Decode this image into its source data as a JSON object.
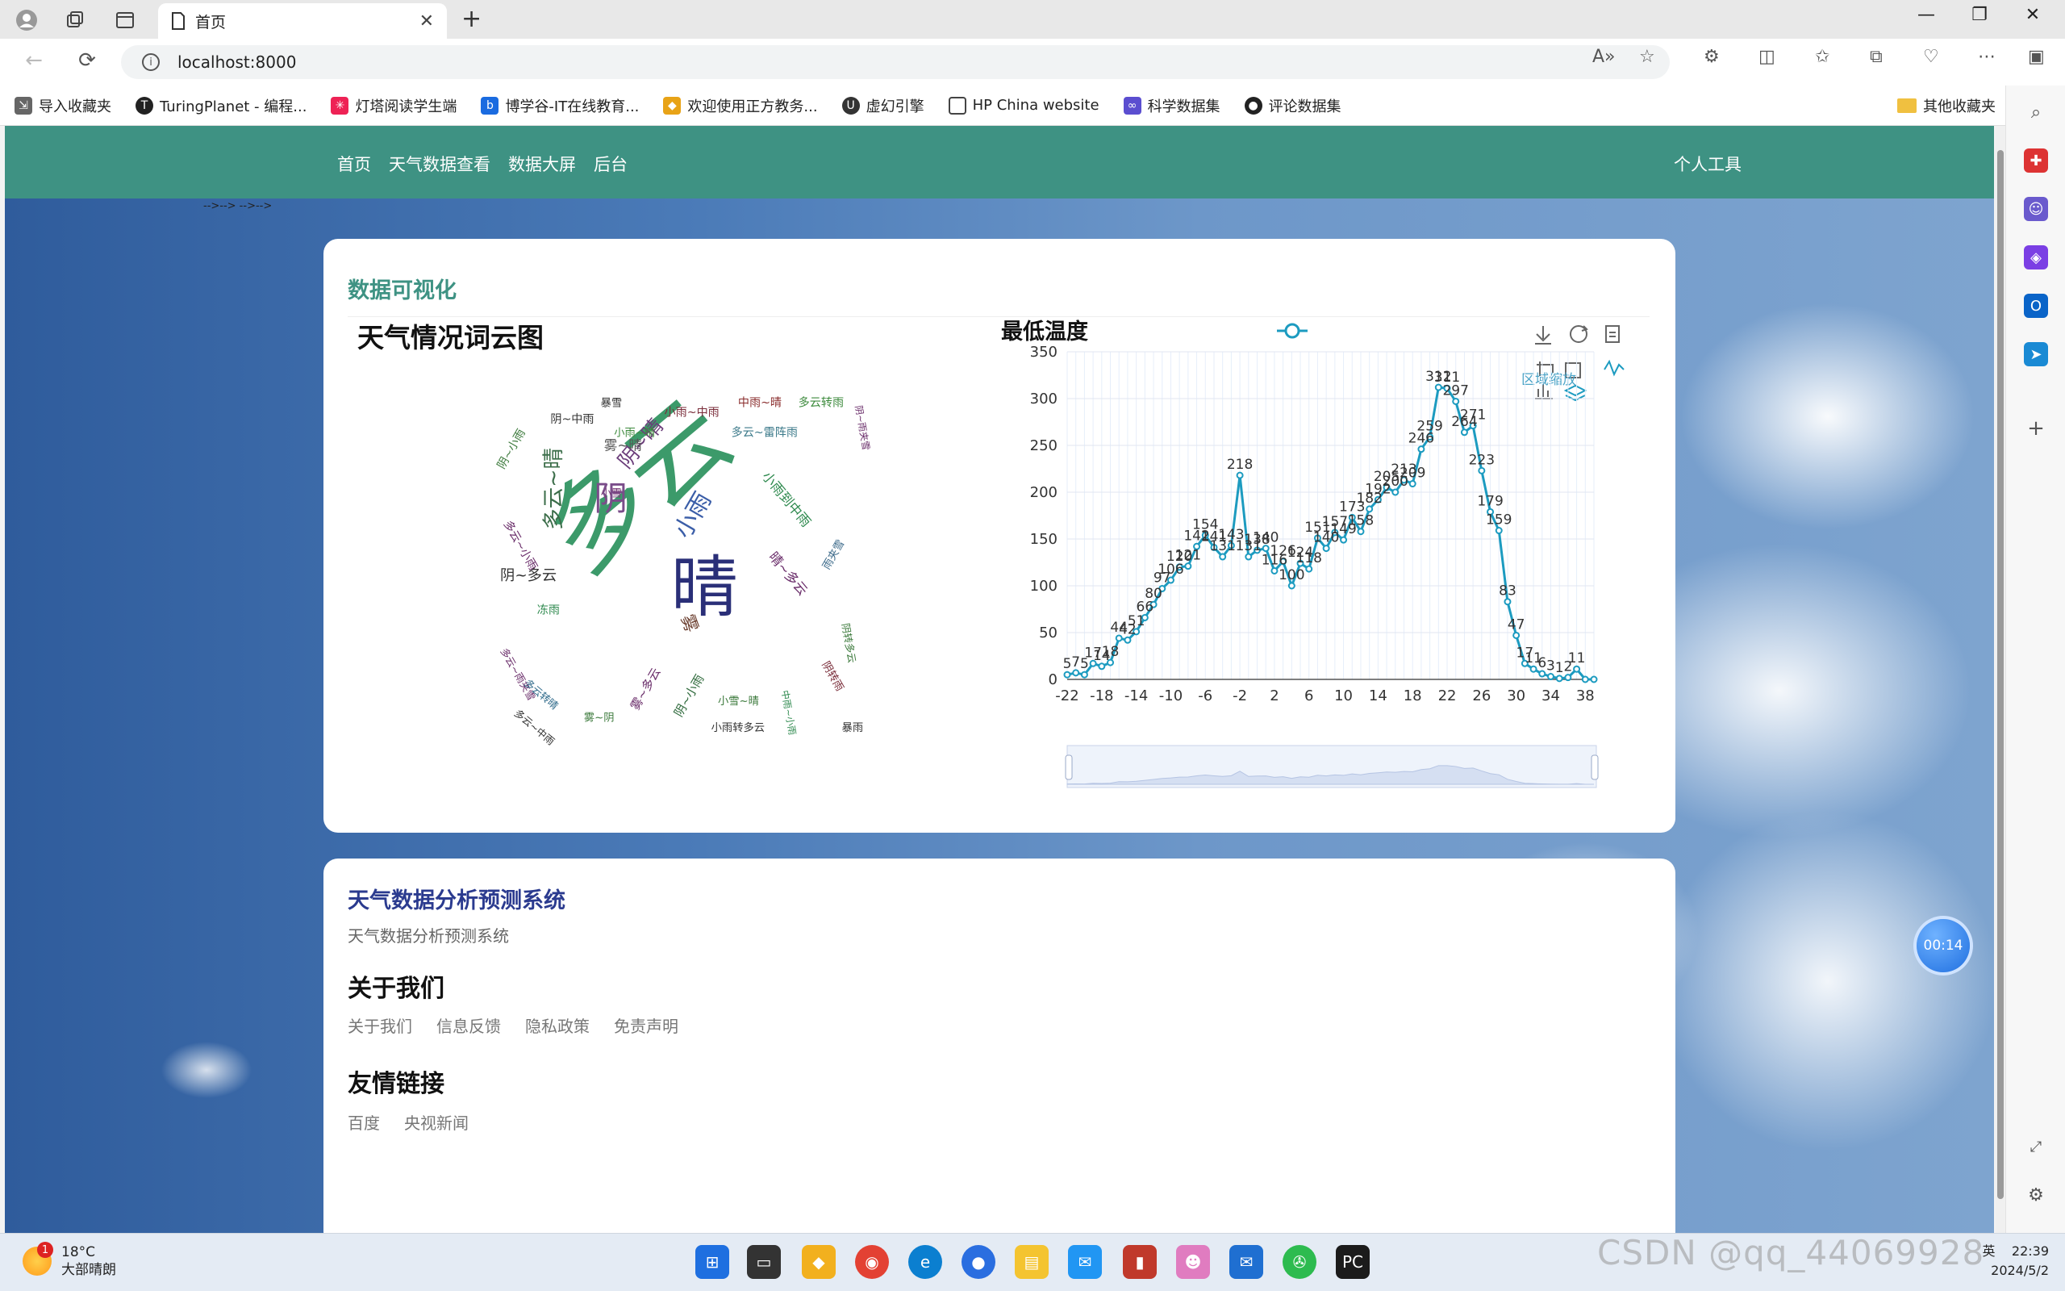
{
  "browser": {
    "tab_title": "首页",
    "url": "localhost:8000",
    "bookmarks": [
      "导入收藏夹",
      "TuringPlanet - 编程...",
      "灯塔阅读学生端",
      "博学谷-IT在线教育...",
      "欢迎使用正方教务...",
      "虚幻引擎",
      "HP China website",
      "科学数据集",
      "评论数据集"
    ],
    "other_bookmarks": "其他收藏夹"
  },
  "site": {
    "nav": [
      "首页",
      "天气数据查看",
      "数据大屏",
      "后台"
    ],
    "tools": "个人工具",
    "breadcrumb": "-->--> -->-->"
  },
  "viz": {
    "section_title": "数据可视化",
    "wordcloud_title": "天气情况词云图",
    "chart_title": "最低温度",
    "zoom_label": "区域缩放"
  },
  "wordcloud": [
    {
      "t": "多云",
      "c": "#3c9a6a",
      "s": 150,
      "x": 155,
      "y": 330,
      "r": -40
    },
    {
      "t": "晴",
      "c": "#2a2f78",
      "s": 100,
      "x": 285,
      "y": 380,
      "r": 0
    },
    {
      "t": "阴",
      "c": "#7a4d8a",
      "s": 50,
      "x": 170,
      "y": 230,
      "r": 0
    },
    {
      "t": "小雨",
      "c": "#3b5ea8",
      "s": 36,
      "x": 310,
      "y": 275,
      "r": -60
    },
    {
      "t": "多云~晴",
      "c": "#3c6e4a",
      "s": 32,
      "x": 120,
      "y": 260,
      "r": -90
    },
    {
      "t": "阴~晴",
      "c": "#6b3d7a",
      "s": 30,
      "x": 220,
      "y": 170,
      "r": -50
    },
    {
      "t": "阴~多云",
      "c": "#333",
      "s": 22,
      "x": 30,
      "y": 335,
      "r": 0
    },
    {
      "t": "小雨到中雨",
      "c": "#2f8a4f",
      "s": 20,
      "x": 420,
      "y": 180,
      "r": 50
    },
    {
      "t": "晴~多云",
      "c": "#6a2d6a",
      "s": 20,
      "x": 430,
      "y": 300,
      "r": 50
    },
    {
      "t": "雾~晴",
      "c": "#555",
      "s": 20,
      "x": 185,
      "y": 140,
      "r": 0
    },
    {
      "t": "小雨~中雨",
      "c": "#7a2d3a",
      "s": 17,
      "x": 275,
      "y": 90,
      "r": 0
    },
    {
      "t": "中雨~晴",
      "c": "#8a2d2d",
      "s": 17,
      "x": 385,
      "y": 75,
      "r": 0
    },
    {
      "t": "多云转雨",
      "c": "#3c8a3c",
      "s": 17,
      "x": 475,
      "y": 75,
      "r": 0
    },
    {
      "t": "多云~雷阵雨",
      "c": "#3c7a8a",
      "s": 17,
      "x": 375,
      "y": 120,
      "r": 0
    },
    {
      "t": "阴~中雨",
      "c": "#333",
      "s": 17,
      "x": 105,
      "y": 100,
      "r": 0
    },
    {
      "t": "暴雪",
      "c": "#333",
      "s": 16,
      "x": 180,
      "y": 75,
      "r": 0
    },
    {
      "t": "小雨~晴",
      "c": "#3c8a3c",
      "s": 16,
      "x": 200,
      "y": 120,
      "r": 0
    },
    {
      "t": "小雪",
      "c": "#7a3d7a",
      "s": 16,
      "x": 180,
      "y": 210,
      "r": 0
    },
    {
      "t": "雾",
      "c": "#6a3d2d",
      "s": 26,
      "x": 300,
      "y": 390,
      "r": 70
    },
    {
      "t": "阴~小雨",
      "c": "#3c7a3c",
      "s": 17,
      "x": 35,
      "y": 170,
      "r": -60
    },
    {
      "t": "多云~小雨",
      "c": "#6a2d6a",
      "s": 17,
      "x": 35,
      "y": 250,
      "r": 60
    },
    {
      "t": "多云~雨夹雪",
      "c": "#6a2d6a",
      "s": 15,
      "x": 30,
      "y": 440,
      "r": 60
    },
    {
      "t": "冻雨",
      "c": "#2f8a4f",
      "s": 17,
      "x": 85,
      "y": 385,
      "r": 0
    },
    {
      "t": "多云转晴",
      "c": "#2f6a8a",
      "s": 15,
      "x": 65,
      "y": 490,
      "r": 40
    },
    {
      "t": "多云~中雨",
      "c": "#333",
      "s": 15,
      "x": 50,
      "y": 535,
      "r": 40
    },
    {
      "t": "雾~阴",
      "c": "#3c7a3c",
      "s": 16,
      "x": 155,
      "y": 545,
      "r": 0
    },
    {
      "t": "雾~多云",
      "c": "#6a2d6a",
      "s": 18,
      "x": 235,
      "y": 530,
      "r": -60
    },
    {
      "t": "阴~小雨",
      "c": "#2f6a3c",
      "s": 18,
      "x": 300,
      "y": 540,
      "r": -60
    },
    {
      "t": "小雪~晴",
      "c": "#3c7a3c",
      "s": 16,
      "x": 355,
      "y": 520,
      "r": 0
    },
    {
      "t": "小雨转多云",
      "c": "#333",
      "s": 16,
      "x": 345,
      "y": 560,
      "r": 0
    },
    {
      "t": "暴雨",
      "c": "#333",
      "s": 16,
      "x": 540,
      "y": 560,
      "r": 0
    },
    {
      "t": "阴转雨",
      "c": "#7a2d3a",
      "s": 16,
      "x": 510,
      "y": 460,
      "r": 60
    },
    {
      "t": "阴转多云",
      "c": "#3c7a3c",
      "s": 15,
      "x": 540,
      "y": 400,
      "r": 80
    },
    {
      "t": "雨夹雪",
      "c": "#3c6a8a",
      "s": 16,
      "x": 520,
      "y": 320,
      "r": -60
    },
    {
      "t": "阴~雨夹雪",
      "c": "#6a2d6a",
      "s": 14,
      "x": 560,
      "y": 75,
      "r": 80
    },
    {
      "t": "中雨~小雨",
      "c": "#2f8a4f",
      "s": 14,
      "x": 450,
      "y": 500,
      "r": 80
    }
  ],
  "chart_data": {
    "type": "line",
    "title": "最低温度",
    "x": [
      -22,
      -21,
      -20,
      -19,
      -18,
      -17,
      -16,
      -15,
      -14,
      -13,
      -12,
      -11,
      -10,
      -9,
      -8,
      -7,
      -6,
      -5,
      -4,
      -3,
      -2,
      -1,
      0,
      1,
      2,
      3,
      4,
      5,
      6,
      7,
      8,
      9,
      10,
      11,
      12,
      13,
      14,
      15,
      16,
      17,
      18,
      19,
      20,
      21,
      22,
      23,
      24,
      25,
      26,
      27,
      28,
      29,
      30,
      31,
      32,
      33,
      34,
      35,
      36,
      37,
      38,
      39
    ],
    "values": [
      5,
      7,
      5,
      17,
      14,
      18,
      44,
      42,
      51,
      66,
      80,
      97,
      106,
      120,
      121,
      142,
      154,
      141,
      131,
      143,
      218,
      131,
      138,
      140,
      116,
      126,
      100,
      124,
      118,
      151,
      140,
      157,
      149,
      173,
      158,
      182,
      192,
      205,
      200,
      213,
      209,
      246,
      259,
      312,
      311,
      297,
      264,
      271,
      223,
      179,
      159,
      83,
      47,
      17,
      11,
      6,
      3,
      1,
      2,
      11,
      0,
      0
    ],
    "xticks": [
      -22,
      -18,
      -14,
      -10,
      -6,
      -2,
      2,
      6,
      10,
      14,
      18,
      22,
      26,
      30,
      34,
      38
    ],
    "xtick_labels": [
      "-22",
      "-18",
      "-14",
      "-10",
      "-6",
      "-2",
      "2",
      "6",
      "10",
      "14",
      "18",
      "22",
      "26",
      "30",
      "34",
      "38"
    ],
    "ylim": [
      0,
      350
    ],
    "yticks": [
      0,
      50,
      100,
      150,
      200,
      250,
      300,
      350
    ],
    "grid": true,
    "color": "#1c9bc0"
  },
  "footer": {
    "system_title": "天气数据分析预测系统",
    "system_sub": "天气数据分析预测系统",
    "about_title": "关于我们",
    "about_links": [
      "关于我们",
      "信息反馈",
      "隐私政策",
      "免责声明"
    ],
    "friends_title": "友情链接",
    "friend_links": [
      "百度",
      "央视新闻"
    ],
    "timer": "00:14"
  },
  "taskbar": {
    "temp": "18°C",
    "weather": "大部晴朗",
    "badge": "1",
    "time": "22:39",
    "date": "2024/5/2",
    "ime": "英",
    "watermark": "CSDN @qq_44069928"
  }
}
